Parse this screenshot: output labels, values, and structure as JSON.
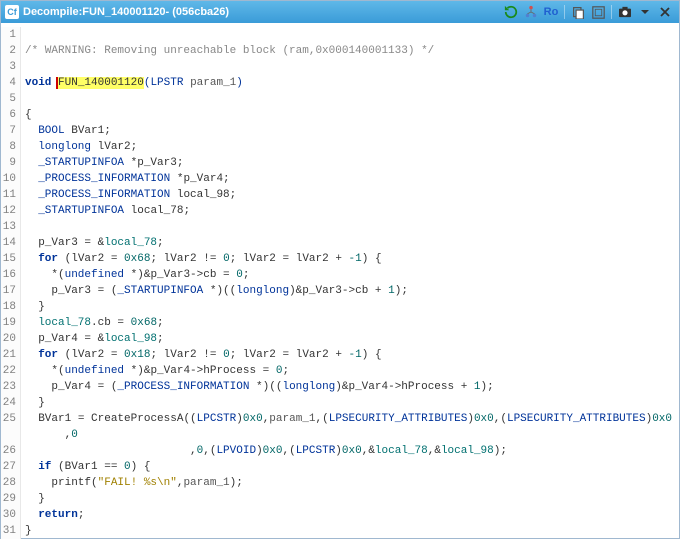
{
  "titlebar": {
    "icon_label": "Cf",
    "prefix": "Decompile: ",
    "function_name": "FUN_140001120",
    "hash": " -  (056cba26)"
  },
  "toolbar": {
    "refresh": "refresh-icon",
    "tree": "tree-icon",
    "ro": "Ro",
    "copy": "copy-icon",
    "snapshot": "snapshot-icon",
    "camera": "camera-icon",
    "dropdown": "dropdown-icon",
    "close": "close-icon"
  },
  "lines": {
    "1": "",
    "2_comment": "/* WARNING: Removing unreachable block (ram,0x000140001133) */",
    "3": "",
    "4_void": "void ",
    "4_fun": "FUN_140001120",
    "4_sig": "(LPSTR param_1)",
    "5": "",
    "6": "{",
    "7": "  BOOL BVar1;",
    "8": "  longlong lVar2;",
    "9": "  _STARTUPINFOA *p_Var3;",
    "10": "  _PROCESS_INFORMATION *p_Var4;",
    "11": "  _PROCESS_INFORMATION local_98;",
    "12": "  _STARTUPINFOA local_78;",
    "13": "  ",
    "14": "  p_Var3 = &local_78;",
    "15": "  for (lVar2 = 0x68; lVar2 != 0; lVar2 = lVar2 + -1) {",
    "16": "    *(undefined *)&p_Var3->cb = 0;",
    "17": "    p_Var3 = (_STARTUPINFOA *)((longlong)&p_Var3->cb + 1);",
    "18": "  }",
    "19": "  local_78.cb = 0x68;",
    "20": "  p_Var4 = &local_98;",
    "21": "  for (lVar2 = 0x18; lVar2 != 0; lVar2 = lVar2 + -1) {",
    "22": "    *(undefined *)&p_Var4->hProcess = 0;",
    "23": "    p_Var4 = (_PROCESS_INFORMATION *)((longlong)&p_Var4->hProcess + 1);",
    "24": "  }",
    "25a": "  BVar1 = CreateProcessA((LPCSTR)0x0,param_1,(LPSECURITY_ATTRIBUTES)0x0,(LPSECURITY_ATTRIBUTES)0x0",
    "25b": "      ,0",
    "26": "                         ,0,(LPVOID)0x0,(LPCSTR)0x0,&local_78,&local_98);",
    "27": "  if (BVar1 == 0) {",
    "28": "    printf(\"FAIL! %s\\n\",param_1);",
    "29": "  }",
    "30": "  return;",
    "31": "}"
  }
}
